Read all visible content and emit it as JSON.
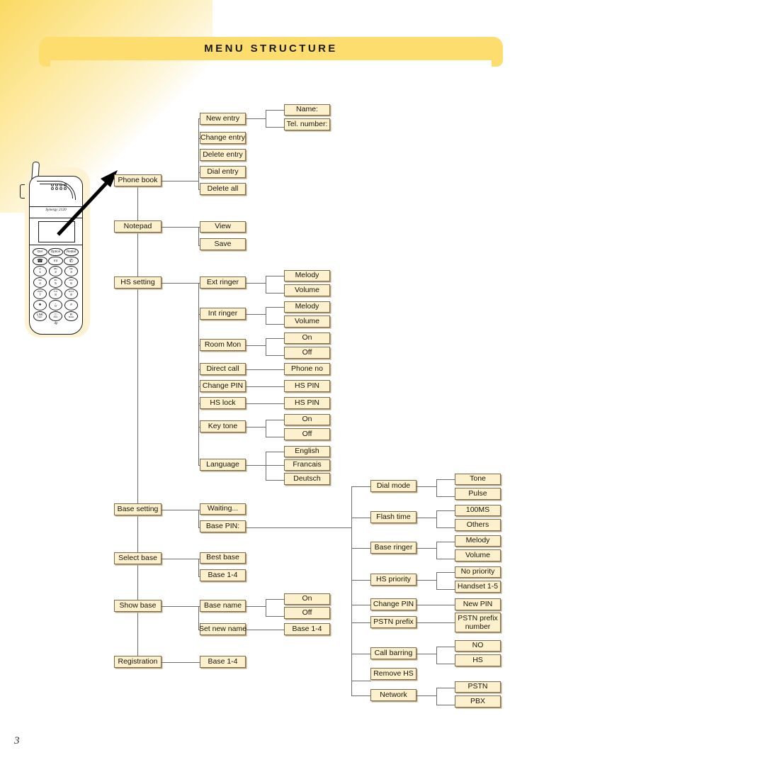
{
  "page": {
    "title": "MENU STRUCTURE",
    "number": "3",
    "accent_color": "#fcdd6d",
    "box_fill": "#fdf1cd",
    "box_border": "#7a6a4e"
  },
  "phone": {
    "model_label": "Synergy 2120",
    "brand_mark": "dp",
    "soft_keys": [
      "Del",
      "Option",
      "Redial"
    ],
    "call_keys": [
      "Talk",
      "Int",
      "End"
    ],
    "keypad": [
      {
        "main": "1",
        "sub": "oo"
      },
      {
        "main": "2",
        "sub": "ABC"
      },
      {
        "main": "3",
        "sub": "DEF"
      },
      {
        "main": "4",
        "sub": "GHI"
      },
      {
        "main": "5",
        "sub": "JKL"
      },
      {
        "main": "6",
        "sub": "MNO"
      },
      {
        "main": "7",
        "sub": "PQRS"
      },
      {
        "main": "8",
        "sub": "TUV"
      },
      {
        "main": "9",
        "sub": "WXYZ"
      },
      {
        "main": "✱",
        "sub": ""
      },
      {
        "main": "0",
        "sub": "␣"
      },
      {
        "main": "#",
        "sub": ""
      }
    ],
    "bottom_keys": [
      {
        "main": "LNK",
        "sub": "Flash"
      },
      {
        "main": "ⓘ",
        "sub": "Mute"
      },
      {
        "main": "R",
        "sub": "Redial"
      }
    ]
  },
  "menu": {
    "root_items": [
      "Phone book",
      "Notepad",
      "HS setting",
      "Base setting",
      "Select base",
      "Show base",
      "Registration"
    ],
    "phone_book": {
      "items": [
        "New entry",
        "Change entry",
        "Delete entry",
        "Dial entry",
        "Delete all"
      ],
      "new_entry_children": [
        "Name:",
        "Tel. number:"
      ]
    },
    "notepad": {
      "items": [
        "View",
        "Save"
      ]
    },
    "hs_setting": {
      "items": [
        "Ext ringer",
        "Int ringer",
        "Room Mon",
        "Direct call",
        "Change PIN",
        "HS lock",
        "Key tone",
        "Language"
      ],
      "ext_ringer_children": [
        "Melody",
        "Volume"
      ],
      "int_ringer_children": [
        "Melody",
        "Volume"
      ],
      "room_mon_children": [
        "On",
        "Off"
      ],
      "direct_call_children": [
        "Phone no"
      ],
      "change_pin_children": [
        "HS PIN"
      ],
      "hs_lock_children": [
        "HS PIN"
      ],
      "key_tone_children": [
        "On",
        "Off"
      ],
      "language_children": [
        "English",
        "Francais",
        "Deutsch"
      ]
    },
    "base_setting": {
      "items": [
        "Waiting...",
        "Base PIN:"
      ]
    },
    "select_base": {
      "items": [
        "Best base",
        "Base 1-4"
      ]
    },
    "show_base": {
      "items": [
        "Base name",
        "Set new name"
      ],
      "base_name_children": [
        "On",
        "Off"
      ],
      "set_new_name_children": [
        "Base 1-4"
      ]
    },
    "registration": {
      "items": [
        "Base 1-4"
      ]
    },
    "base_pin_menu": {
      "items": [
        "Dial mode",
        "Flash time",
        "Base ringer",
        "HS priority",
        "Change PIN",
        "PSTN prefix",
        "Call barring",
        "Remove HS",
        "Network"
      ],
      "dial_mode_children": [
        "Tone",
        "Pulse"
      ],
      "flash_time_children": [
        "100MS",
        "Others"
      ],
      "base_ringer_children": [
        "Melody",
        "Volume"
      ],
      "hs_priority_children": [
        "No priority",
        "Handset 1-5"
      ],
      "change_pin_children": [
        "New PIN"
      ],
      "pstn_prefix_children": [
        "PSTN prefix number"
      ],
      "call_barring_children": [
        "NO",
        "HS"
      ],
      "network_children": [
        "PSTN",
        "PBX"
      ]
    }
  }
}
